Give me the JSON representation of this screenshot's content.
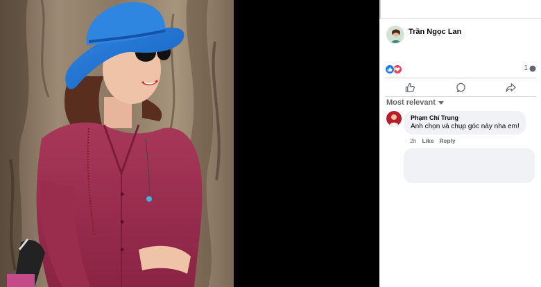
{
  "post": {
    "author_name": "Trần Ngọc Lan",
    "reactions": [
      "like-icon",
      "love-icon"
    ],
    "comment_count": "1"
  },
  "comments_section": {
    "sort_label": "Most relevant",
    "comments": [
      {
        "author": "Phạm Chí Trung",
        "text": "Anh chọn và chụp góc này nha em!",
        "time": "2h",
        "like_label": "Like",
        "reply_label": "Reply"
      }
    ]
  },
  "colors": {
    "facebook_blue": "#1877f2",
    "love_red": "#f33e58",
    "secondary_text": "#65676b",
    "bubble_bg": "#f0f2f5"
  }
}
